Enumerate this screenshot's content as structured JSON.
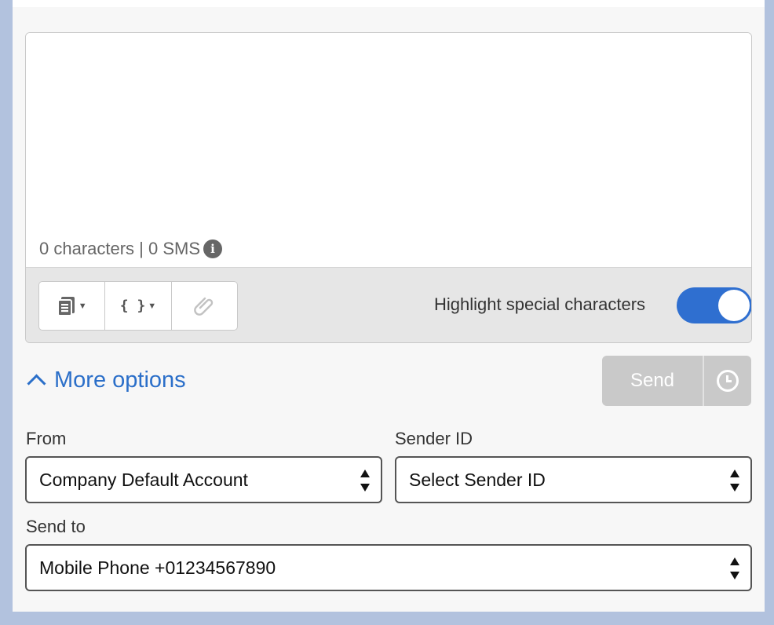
{
  "composer": {
    "message_value": "",
    "counter_text": "0 characters | 0 SMS",
    "info_icon": "info-icon",
    "toolbar": {
      "templates_icon": "templates-icon",
      "variables_label": "{ }",
      "attachment_icon": "attachment-icon"
    },
    "highlight_label": "Highlight special characters",
    "highlight_enabled": true
  },
  "more_options_label": "More options",
  "send": {
    "label": "Send",
    "schedule_icon": "clock-icon",
    "disabled": true
  },
  "from": {
    "label": "From",
    "value": "Company Default Account"
  },
  "sender_id": {
    "label": "Sender ID",
    "value": "Select Sender ID"
  },
  "send_to": {
    "label": "Send to",
    "value": "Mobile Phone +01234567890"
  },
  "colors": {
    "accent": "#2b6fc9",
    "toggle_on": "#2f6fd0",
    "send_disabled": "#c9c9c9",
    "page_background": "#b2c2de"
  }
}
